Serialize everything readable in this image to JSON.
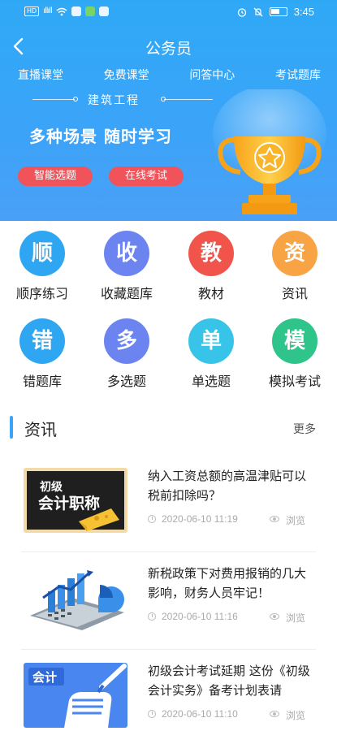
{
  "status_bar": {
    "time": "3:45"
  },
  "header": {
    "title": "公务员",
    "tabs": [
      "直播课堂",
      "免费课堂",
      "问答中心",
      "考试题库"
    ],
    "subject": "建筑工程",
    "slogan": "多种场景  随时学习",
    "buttons": [
      "智能选题",
      "在线考试"
    ]
  },
  "quick_grid": [
    {
      "glyph": "顺",
      "label": "顺序练习",
      "color": "#2fa6f2",
      "icon": "order-practice-icon"
    },
    {
      "glyph": "收",
      "label": "收藏题库",
      "color": "#6c84f0",
      "icon": "favorites-icon"
    },
    {
      "glyph": "教",
      "label": "教材",
      "color": "#f0544a",
      "icon": "textbook-icon"
    },
    {
      "glyph": "资",
      "label": "资讯",
      "color": "#f8a444",
      "icon": "news-icon"
    },
    {
      "glyph": "错",
      "label": "错题库",
      "color": "#2fa6f2",
      "icon": "wrong-questions-icon"
    },
    {
      "glyph": "多",
      "label": "多选题",
      "color": "#6c84f0",
      "icon": "multi-choice-icon"
    },
    {
      "glyph": "单",
      "label": "单选题",
      "color": "#38c4e8",
      "icon": "single-choice-icon"
    },
    {
      "glyph": "模",
      "label": "模拟考试",
      "color": "#2fc48a",
      "icon": "mock-exam-icon"
    }
  ],
  "news": {
    "title": "资讯",
    "more": "更多",
    "items": [
      {
        "title": "纳入工资总额的高温津贴可以税前扣除吗？",
        "time": "2020-06-10 11:19",
        "views": "浏览",
        "thumb": {
          "line1": "初级",
          "line2": "会计职称"
        }
      },
      {
        "title": "新税政策下对费用报销的几大影响，财务人员牢记！",
        "time": "2020-06-10 11:16",
        "views": "浏览"
      },
      {
        "title": "初级会计考试延期 这份《初级会计实务》备考计划表请",
        "time": "2020-06-10 11:10",
        "views": "浏览",
        "thumb": {
          "tag": "会计"
        }
      }
    ]
  }
}
